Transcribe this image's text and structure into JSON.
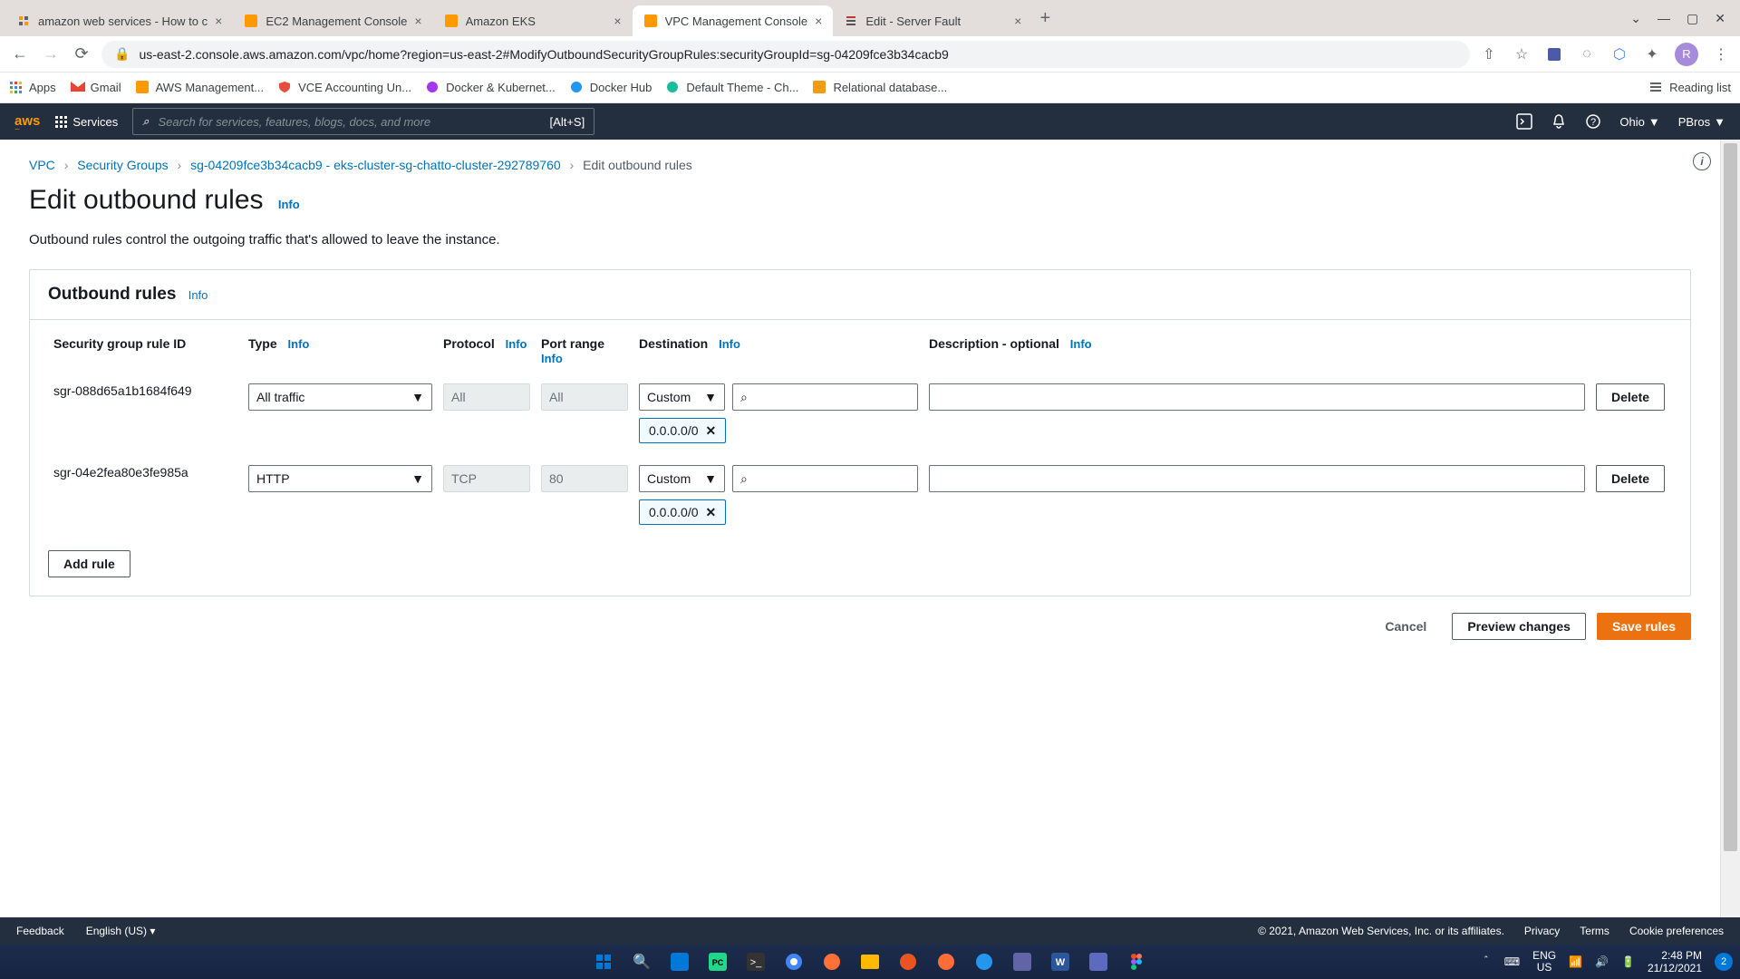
{
  "browser": {
    "tabs": [
      {
        "title": "amazon web services - How to c"
      },
      {
        "title": "EC2 Management Console"
      },
      {
        "title": "Amazon EKS"
      },
      {
        "title": "VPC Management Console"
      },
      {
        "title": "Edit - Server Fault"
      }
    ],
    "url": "us-east-2.console.aws.amazon.com/vpc/home?region=us-east-2#ModifyOutboundSecurityGroupRules:securityGroupId=sg-04209fce3b34cacb9",
    "profile_letter": "R",
    "bookmarks": {
      "apps": "Apps",
      "gmail": "Gmail",
      "aws": "AWS Management...",
      "vce": "VCE Accounting Un...",
      "docker": "Docker & Kubernet...",
      "dockerhub": "Docker Hub",
      "theme": "Default Theme - Ch...",
      "reldb": "Relational database...",
      "reading": "Reading list"
    }
  },
  "aws": {
    "logo": "aws",
    "services": "Services",
    "search_placeholder": "Search for services, features, blogs, docs, and more",
    "search_hint": "[Alt+S]",
    "region": "Ohio",
    "account": "PBros"
  },
  "breadcrumb": {
    "vpc": "VPC",
    "sg": "Security Groups",
    "sgid": "sg-04209fce3b34cacb9 - eks-cluster-sg-chatto-cluster-292789760",
    "current": "Edit outbound rules"
  },
  "page": {
    "title": "Edit outbound rules",
    "info": "Info",
    "description": "Outbound rules control the outgoing traffic that's allowed to leave the instance."
  },
  "panel": {
    "title": "Outbound rules",
    "info": "Info",
    "headers": {
      "ruleid": "Security group rule ID",
      "type": "Type",
      "protocol": "Protocol",
      "portrange": "Port range",
      "destination": "Destination",
      "description": "Description - optional"
    },
    "rules": [
      {
        "id": "sgr-088d65a1b1684f649",
        "type": "All traffic",
        "protocol": "All",
        "port": "All",
        "dest_mode": "Custom",
        "cidr": "0.0.0.0/0"
      },
      {
        "id": "sgr-04e2fea80e3fe985a",
        "type": "HTTP",
        "protocol": "TCP",
        "port": "80",
        "dest_mode": "Custom",
        "cidr": "0.0.0.0/0"
      }
    ],
    "delete": "Delete",
    "add_rule": "Add rule"
  },
  "actions": {
    "cancel": "Cancel",
    "preview": "Preview changes",
    "save": "Save rules"
  },
  "footer": {
    "feedback": "Feedback",
    "language": "English (US)",
    "copyright": "© 2021, Amazon Web Services, Inc. or its affiliates.",
    "privacy": "Privacy",
    "terms": "Terms",
    "cookie": "Cookie preferences"
  },
  "taskbar": {
    "lang1": "ENG",
    "lang2": "US",
    "time": "2:48 PM",
    "date": "21/12/2021",
    "notif": "2"
  }
}
